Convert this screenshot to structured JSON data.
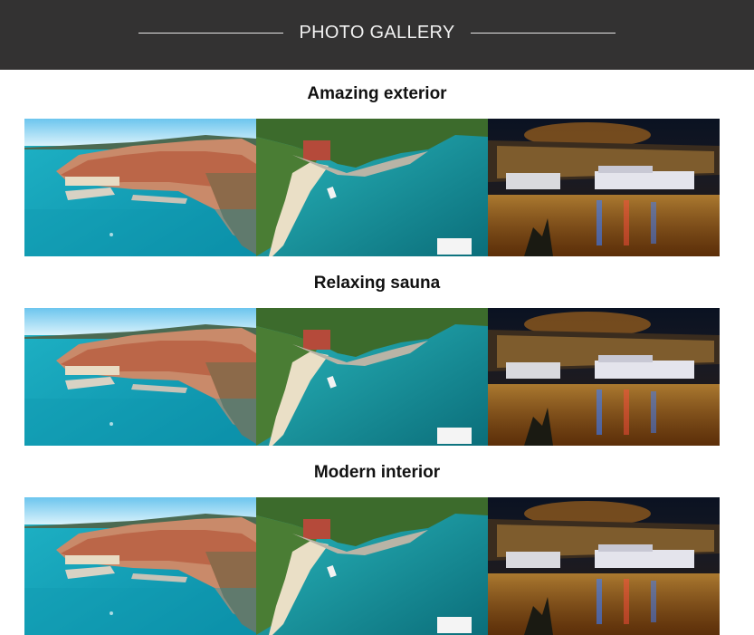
{
  "header": {
    "title": "PHOTO GALLERY"
  },
  "sections": [
    {
      "title": "Amazing exterior",
      "photos": [
        {
          "name": "old-town-coast-photo"
        },
        {
          "name": "beach-aerial-photo"
        },
        {
          "name": "harbor-night-photo"
        }
      ]
    },
    {
      "title": "Relaxing sauna",
      "photos": [
        {
          "name": "old-town-coast-photo"
        },
        {
          "name": "beach-aerial-photo"
        },
        {
          "name": "harbor-night-photo"
        }
      ]
    },
    {
      "title": "Modern interior",
      "photos": [
        {
          "name": "old-town-coast-photo"
        },
        {
          "name": "beach-aerial-photo"
        },
        {
          "name": "harbor-night-photo"
        }
      ]
    }
  ],
  "colors": {
    "header_bg": "#333232",
    "header_text": "#f2f2f2",
    "page_bg": "#ffffff"
  }
}
